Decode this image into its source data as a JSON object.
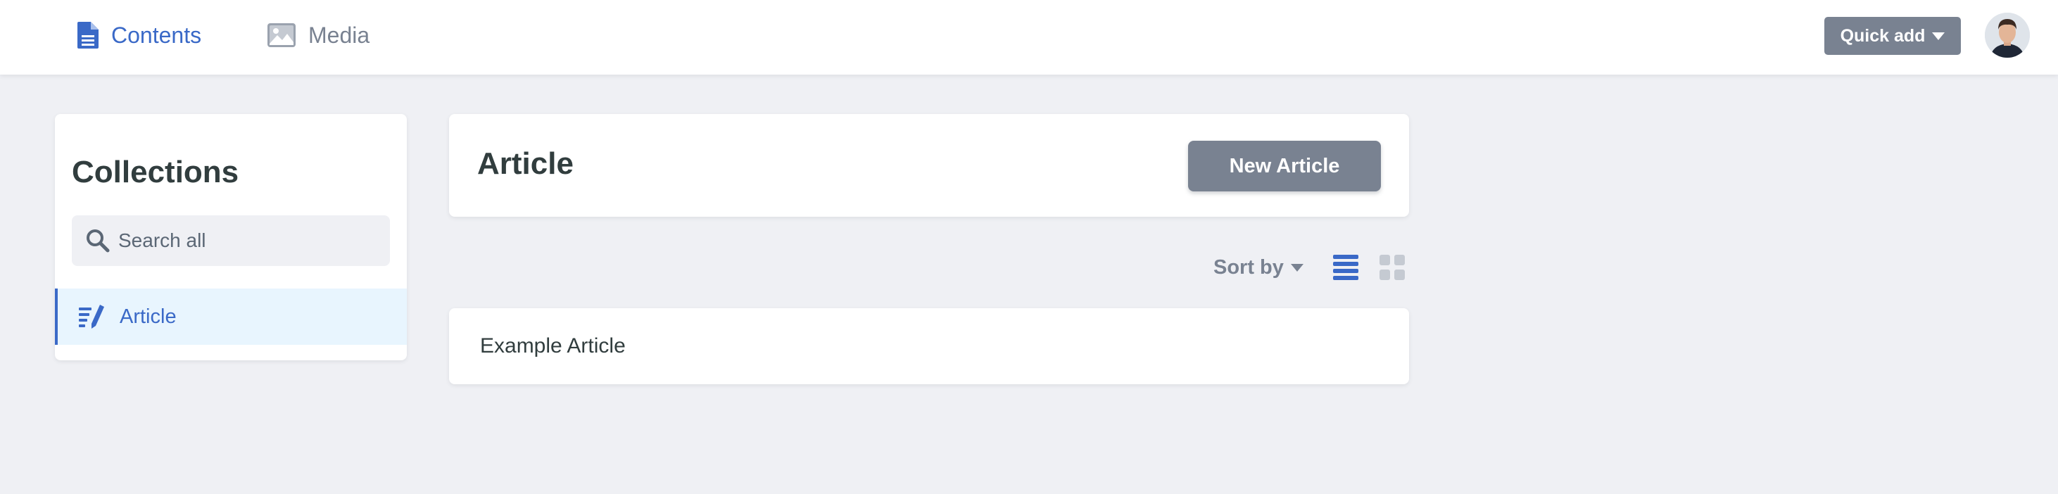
{
  "topbar": {
    "nav": [
      {
        "label": "Contents",
        "icon": "document-icon",
        "active": true
      },
      {
        "label": "Media",
        "icon": "image-icon",
        "active": false
      }
    ],
    "quick_add_label": "Quick add",
    "avatar_icon": "user-avatar"
  },
  "sidebar": {
    "title": "Collections",
    "search_placeholder": "Search all",
    "items": [
      {
        "label": "Article",
        "icon": "article-icon",
        "active": true
      }
    ]
  },
  "main": {
    "collection_title": "Article",
    "new_button_label": "New Article",
    "sort_label": "Sort by",
    "view_modes": [
      "list",
      "grid"
    ],
    "active_view": "list",
    "entries": [
      {
        "title": "Example Article"
      }
    ]
  },
  "colors": {
    "accent": "#3a69c7",
    "button_gray": "#798291",
    "background": "#eff0f4",
    "active_item_bg": "#e8f5fe",
    "text_dark": "#313d3e"
  }
}
